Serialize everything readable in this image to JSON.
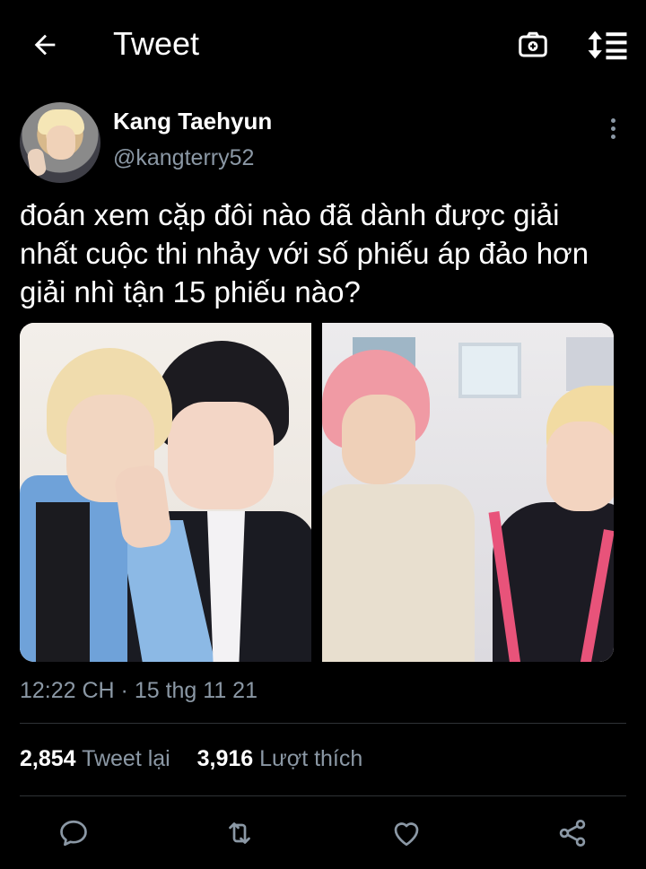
{
  "header": {
    "title": "Tweet",
    "icons": [
      "back-arrow-icon",
      "camera-icon",
      "sort-icon"
    ]
  },
  "author": {
    "display_name": "Kang Taehyun",
    "handle": "@kangterry52"
  },
  "tweet": {
    "text_lines": [
      "đoán xem cặp đôi nào đã dành được giải",
      "nhất cuộc thi nhảy với số phiếu áp đảo hơn",
      "giải nhì tận 15 phiếu nào?"
    ],
    "timestamp": "12:22 CH · 15 thg 11 21",
    "retweet_count": "2,854",
    "retweet_label": "Tweet lại",
    "like_count": "3,916",
    "like_label": "Lượt thích"
  },
  "actions": [
    "reply-icon",
    "retweet-icon",
    "like-icon",
    "share-icon"
  ],
  "colors": {
    "background": "#000000",
    "text_primary": "#ffffff",
    "text_secondary": "#8b98a5",
    "divider": "#2f3336"
  }
}
